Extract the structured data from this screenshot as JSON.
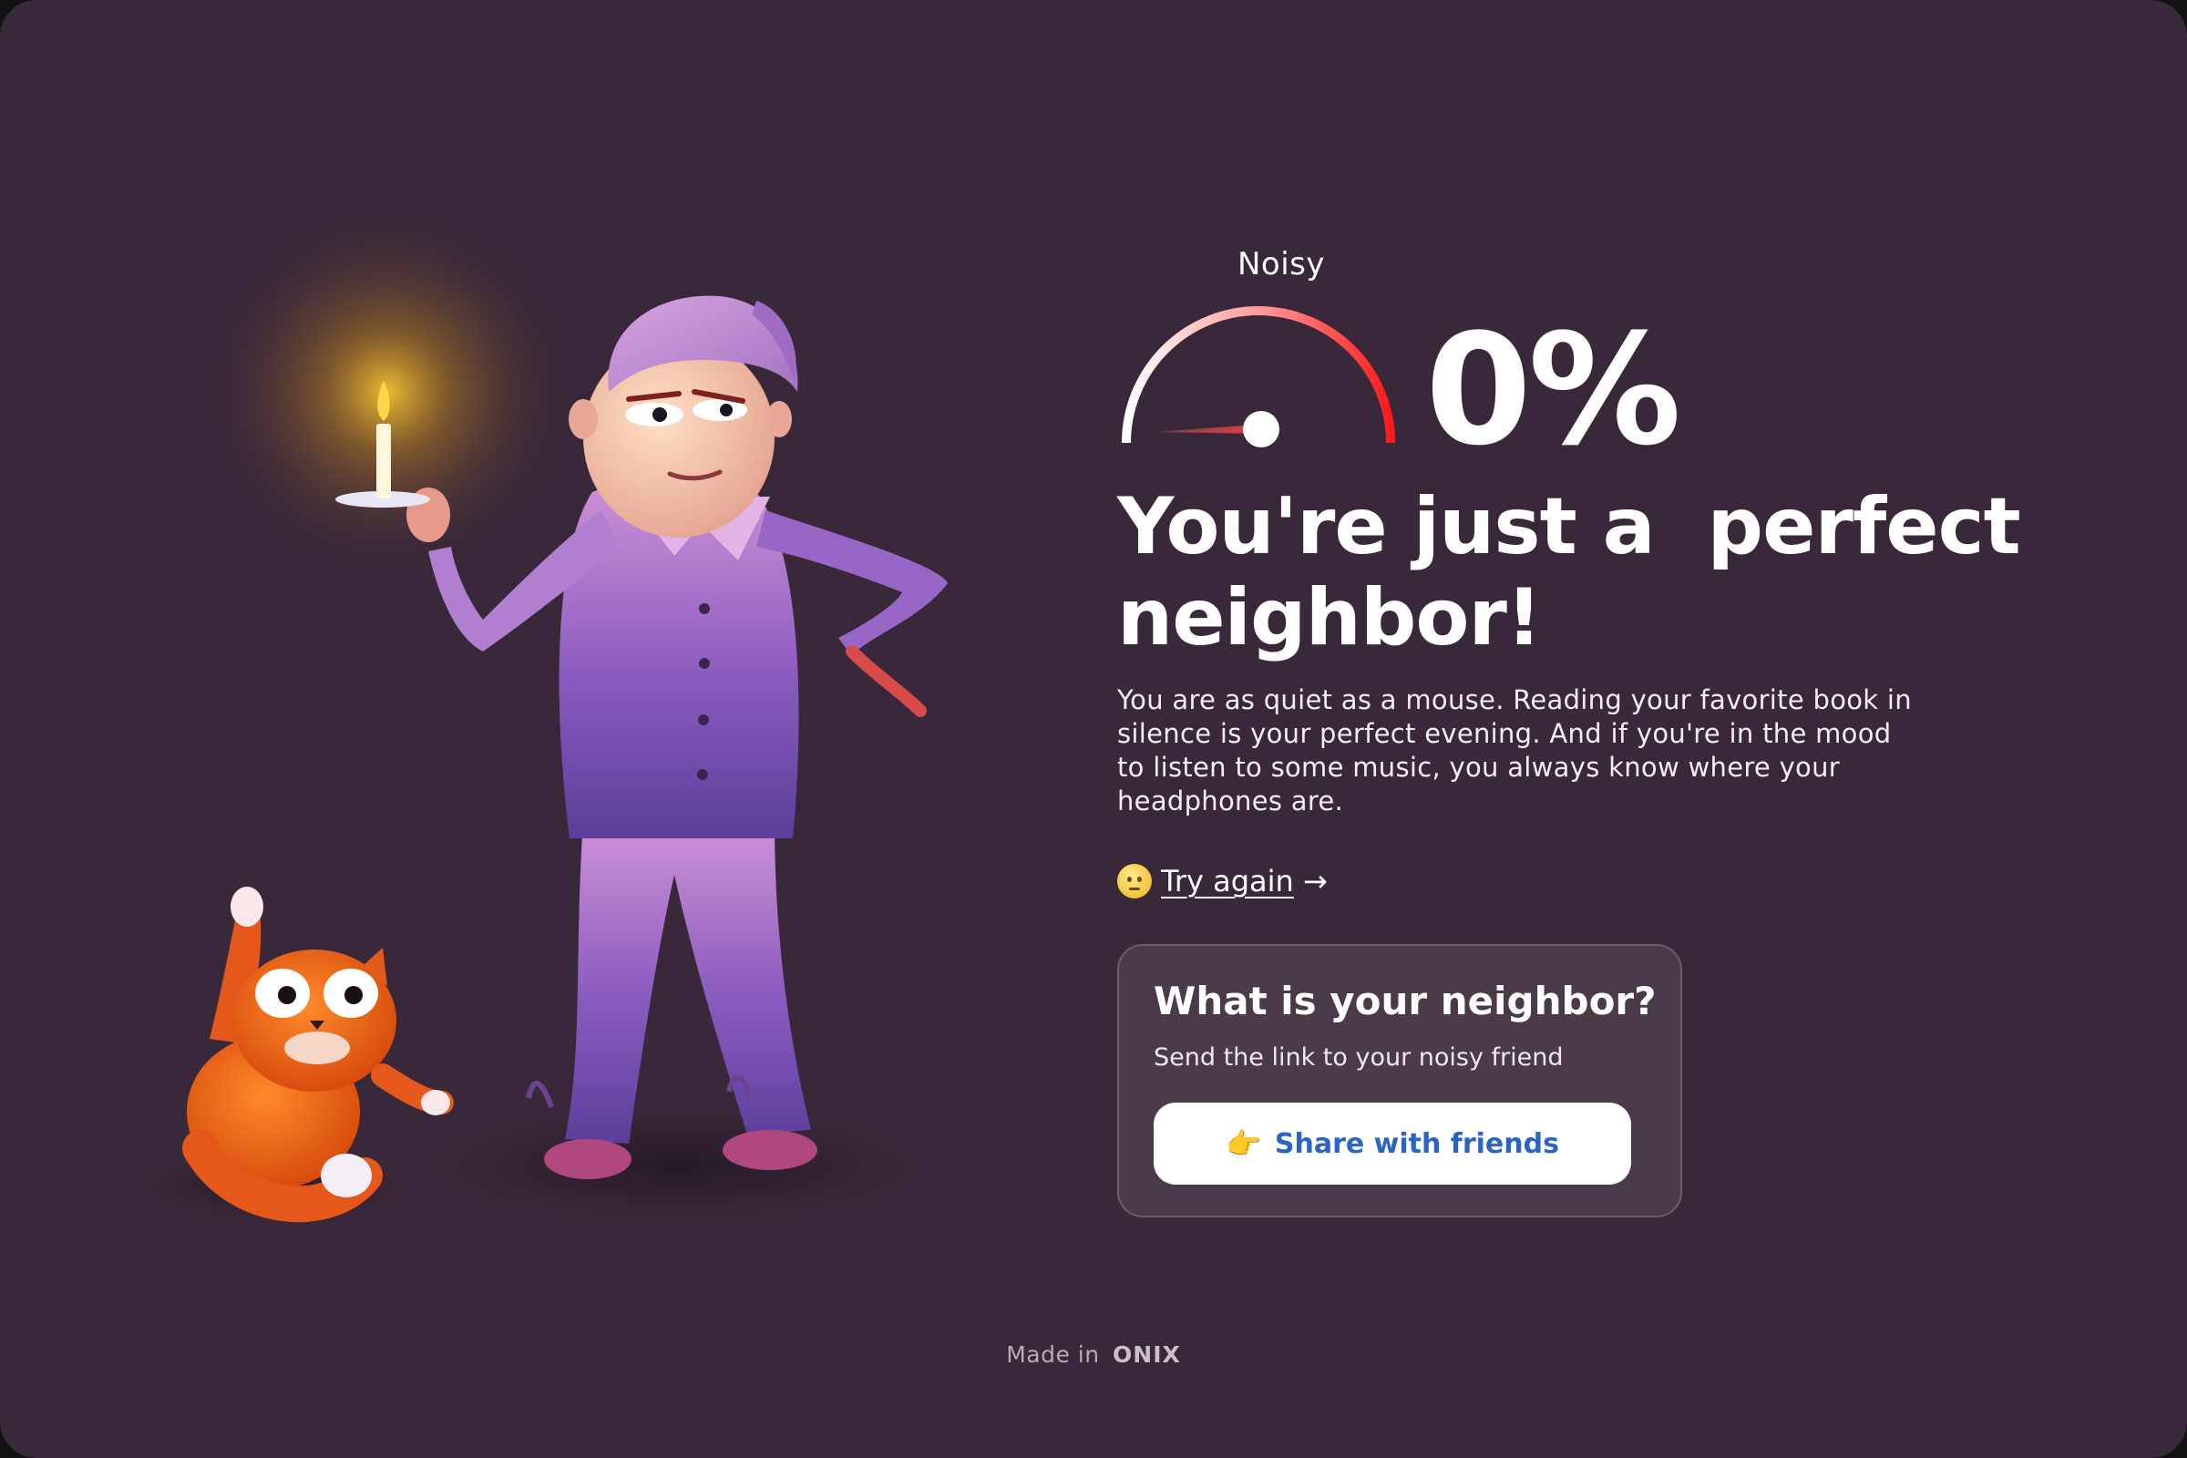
{
  "gauge": {
    "label": "Noisy",
    "value_percent": 0,
    "colors": {
      "start": "#ffffff",
      "end": "#ff1a1a",
      "needle": "#e03a3a",
      "hub": "#ffffff"
    }
  },
  "result": {
    "percent_text": "0%",
    "headline": "You're just a  perfect neighbor!",
    "description": "You are as quiet as a mouse. Reading your favorite book in silence is your perfect evening. And if you're in the mood to listen to some music, you always know where your headphones are."
  },
  "try_again": {
    "icon": "neutral-face-emoji",
    "label": "Try again",
    "arrow": "→"
  },
  "share_card": {
    "title": "What is your neighbor?",
    "subtitle": "Send the link to your noisy friend",
    "button_icon": "👉",
    "button_label": "Share with friends"
  },
  "footer": {
    "made_in": "Made in",
    "brand": "ONIX"
  },
  "theme": {
    "background": "#392839",
    "card_background": "#4a3a4a",
    "accent_blue": "#2a64c4",
    "accent_red": "#ff1a1a"
  },
  "illustration": {
    "character": "man-in-pajamas-with-candle",
    "pet": "orange-cat"
  }
}
